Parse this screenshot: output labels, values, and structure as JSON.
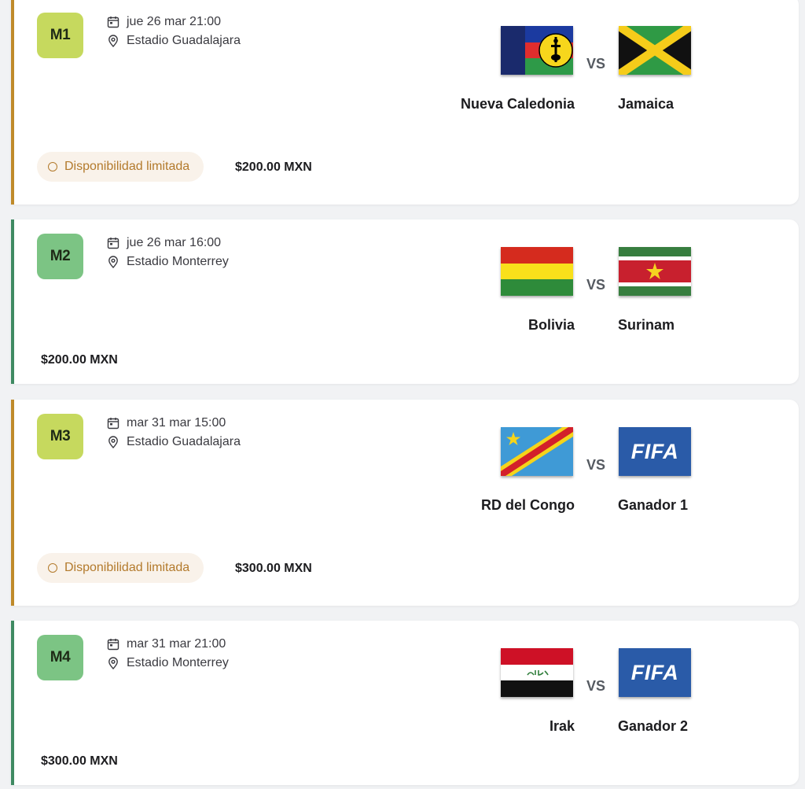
{
  "matches": [
    {
      "code": "M1",
      "datetime": "jue 26 mar 21:00",
      "stadium": "Estadio Guadalajara",
      "home_team": "Nueva Caledonia",
      "away_team": "Jamaica",
      "vs_label": "VS",
      "availability": "Disponibilidad limitada",
      "price": "$200.00 MXN",
      "accent_color": "#bf8a2a"
    },
    {
      "code": "M2",
      "datetime": "jue 26 mar 16:00",
      "stadium": "Estadio Monterrey",
      "home_team": "Bolivia",
      "away_team": "Surinam",
      "vs_label": "VS",
      "price": "$200.00 MXN",
      "accent_color": "#3f8a62"
    },
    {
      "code": "M3",
      "datetime": "mar 31 mar 15:00",
      "stadium": "Estadio Guadalajara",
      "home_team": "RD del Congo",
      "away_team": "Ganador 1",
      "away_logo_text": "FIFA",
      "vs_label": "VS",
      "availability": "Disponibilidad limitada",
      "price": "$300.00 MXN",
      "accent_color": "#bf8a2a"
    },
    {
      "code": "M4",
      "datetime": "mar 31 mar 21:00",
      "stadium": "Estadio Monterrey",
      "home_team": "Irak",
      "away_team": "Ganador 2",
      "away_logo_text": "FIFA",
      "vs_label": "VS",
      "price": "$300.00 MXN",
      "accent_color": "#3f8a62"
    }
  ],
  "icons": {
    "date": "calendar-icon",
    "location": "map-pin-icon",
    "availability": "circle-outline-icon"
  }
}
